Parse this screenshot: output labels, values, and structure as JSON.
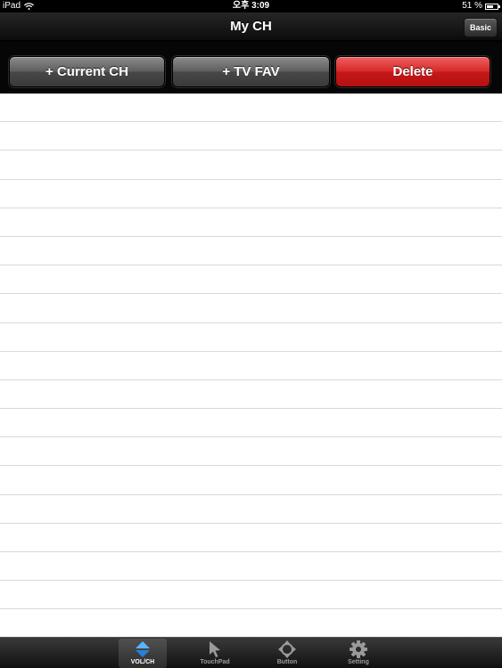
{
  "status_bar": {
    "device": "iPad",
    "time": "오후 3:09",
    "battery_percent": "51 %",
    "battery_level": 0.51
  },
  "nav": {
    "title": "My CH",
    "basic_label": "Basic"
  },
  "actions": {
    "current_ch": "+ Current CH",
    "tv_fav": "+ TV FAV",
    "delete": "Delete"
  },
  "colors": {
    "delete_red": "#d62a2a",
    "selected_tab_blue": "#3a9bf0"
  },
  "tabs": [
    {
      "label": "VOL/CH",
      "icon": "vol-ch-arrows-icon",
      "selected": true
    },
    {
      "label": "TouchPad",
      "icon": "pointer-cursor-icon",
      "selected": false
    },
    {
      "label": "Button",
      "icon": "dpad-icon",
      "selected": false
    },
    {
      "label": "Setting",
      "icon": "gear-icon",
      "selected": false
    }
  ]
}
